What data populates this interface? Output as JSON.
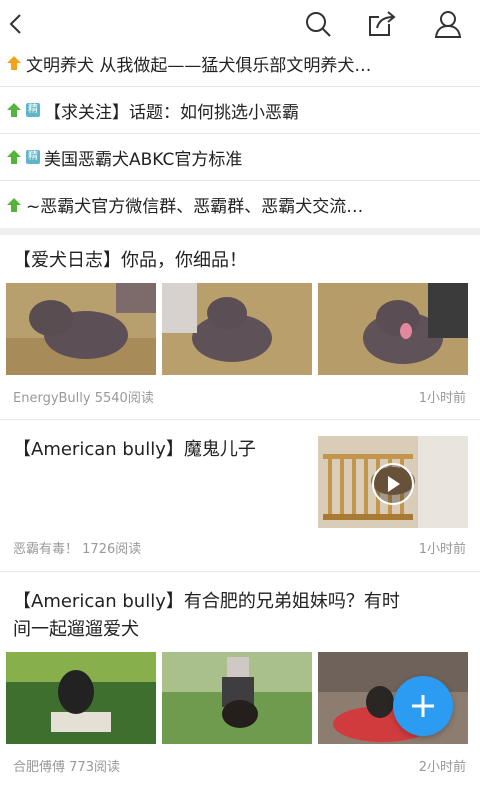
{
  "pinned": [
    {
      "text": "文明养犬 从我做起——猛犬俱乐部文明养犬…",
      "tag": ""
    },
    {
      "text": "【求关注】话题：如何挑选小恶霸",
      "tag": "精"
    },
    {
      "text": "美国恶霸犬ABKC官方标准",
      "tag": "精"
    },
    {
      "text": "~恶霸犬官方微信群、恶霸群、恶霸犬交流…",
      "tag": ""
    }
  ],
  "posts": [
    {
      "title": "【爱犬日志】你品，你细品！",
      "author": "EnergyBully",
      "reads": "5540阅读",
      "time": "1小时前"
    },
    {
      "title": "【American bully】魔鬼儿子",
      "author": "恶霸有毒！",
      "reads": "1726阅读",
      "time": "1小时前"
    },
    {
      "title_line1": "【American bully】有合肥的兄弟姐妹吗？有时",
      "title_line2": "间一起遛遛爱犬",
      "author": "合肥傅傅",
      "reads": "773阅读",
      "time": "2小时前"
    }
  ],
  "colors": {
    "accent": "#2b9cf2",
    "pin_arrow_orange": "#f5a21b",
    "pin_arrow_green": "#55b53b",
    "tag_bg": "#5db7c9"
  },
  "icons": {
    "back": "back-arrow-icon",
    "search": "search-icon",
    "share": "share-icon",
    "profile": "user-icon",
    "add": "plus-icon"
  }
}
